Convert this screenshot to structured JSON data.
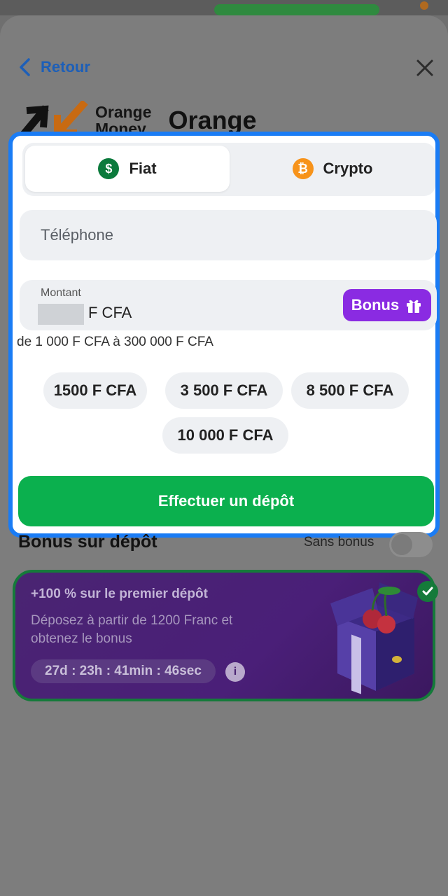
{
  "header": {
    "back_label": "Retour",
    "brand_logo_text_line1": "Orange",
    "brand_logo_text_line2": "Money",
    "title": "Orange"
  },
  "tabs": [
    {
      "label": "Fiat",
      "icon": "dollar-coin-icon",
      "selected": true
    },
    {
      "label": "Crypto",
      "icon": "bitcoin-icon",
      "selected": false
    }
  ],
  "form": {
    "phone_placeholder": "Téléphone",
    "amount_label": "Montant",
    "amount_currency": "F CFA",
    "bonus_button": "Bonus",
    "range_text": "de 1 000 F CFA à 300 000 F CFA",
    "quick_amounts": [
      "1500 F CFA",
      "3 500 F CFA",
      "8 500 F CFA",
      "10 000 F CFA"
    ],
    "submit_label": "Effectuer un dépôt"
  },
  "bonus_section": {
    "title": "Bonus sur dépôt",
    "toggle_label": "Sans bonus",
    "toggle_on": false,
    "promo": {
      "headline": "+100 % sur le premier dépôt",
      "description": "Déposez à partir de 1200 Franc et obtenez le bonus",
      "timer": "27d : 23h : 41min : 46sec",
      "selected": true
    }
  },
  "colors": {
    "accent_blue": "#1a7cf5",
    "submit_green": "#0bb04e",
    "bonus_purple": "#8a2be2",
    "link_blue": "#1d5fb8"
  }
}
